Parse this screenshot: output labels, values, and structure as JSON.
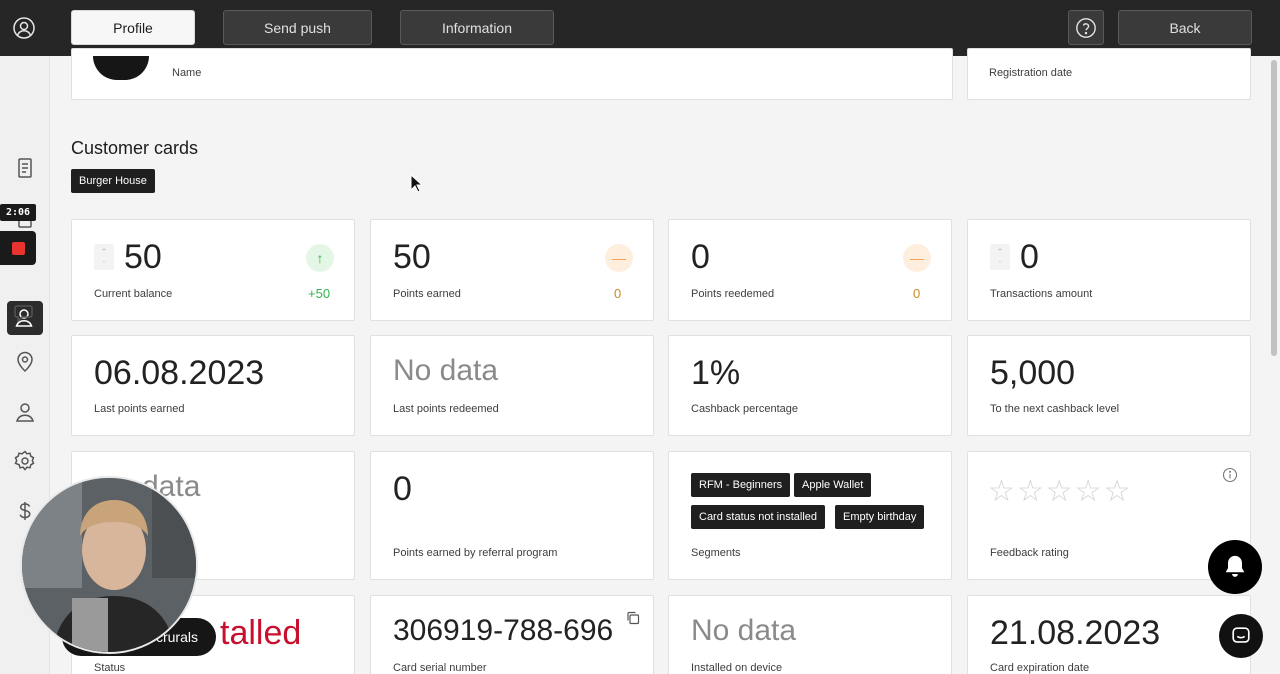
{
  "topbar": {
    "tabs": [
      {
        "label": "Profile",
        "active": true
      },
      {
        "label": "Send push",
        "active": false
      },
      {
        "label": "Information",
        "active": false
      }
    ],
    "help_icon": "question-circle-icon",
    "back_label": "Back"
  },
  "sidebar": {
    "recording_time": "2:06",
    "icons": [
      "user-circle-icon",
      "document-icon",
      "customers-icon",
      "chat-icon",
      "location-pin-icon",
      "person-icon",
      "gear-icon",
      "dollar-icon"
    ]
  },
  "profile": {
    "name_label": "Name",
    "registration_label": "Registration date"
  },
  "customer_cards": {
    "title": "Customer cards",
    "brand_chip": "Burger House"
  },
  "cards": {
    "current_balance": {
      "value": "50",
      "label": "Current balance",
      "delta": "+50"
    },
    "points_earned": {
      "value": "50",
      "label": "Points earned",
      "delta": "0"
    },
    "points_redeemed": {
      "value": "0",
      "label": "Points reedemed",
      "delta": "0"
    },
    "transactions_amount": {
      "value": "0",
      "label": "Transactions amount"
    },
    "last_points_earned": {
      "value": "06.08.2023",
      "label": "Last points earned"
    },
    "last_points_redeemed": {
      "value": "No data",
      "label": "Last points redeemed"
    },
    "cashback_percentage": {
      "value": "1%",
      "label": "Cashback percentage"
    },
    "next_cashback_level": {
      "value": "5,000",
      "label": "To the next cashback level"
    },
    "partial_no_data": {
      "value": "data"
    },
    "referral_points": {
      "value": "0",
      "label": "Points earned by referral program"
    },
    "segments": {
      "label": "Segments",
      "chips": [
        "RFM - Beginners",
        "Apple Wallet",
        "Card status not installed",
        "Empty birthday"
      ]
    },
    "feedback": {
      "label": "Feedback rating",
      "stars": "☆☆☆☆☆",
      "rating_of_5": 0
    },
    "status": {
      "value": "talled",
      "label": "Status"
    },
    "serial": {
      "value": "306919-788-696",
      "label": "Card serial number"
    },
    "device": {
      "value": "No data",
      "label": "Installed on device"
    },
    "expiration": {
      "value": "21.08.2023",
      "label": "Card expiration date"
    }
  },
  "overlay": {
    "pill_text": "crurals"
  },
  "colors": {
    "topbar": "#262626",
    "green": "#33b34d",
    "orange": "#f0a04b",
    "red": "#c8102e"
  }
}
